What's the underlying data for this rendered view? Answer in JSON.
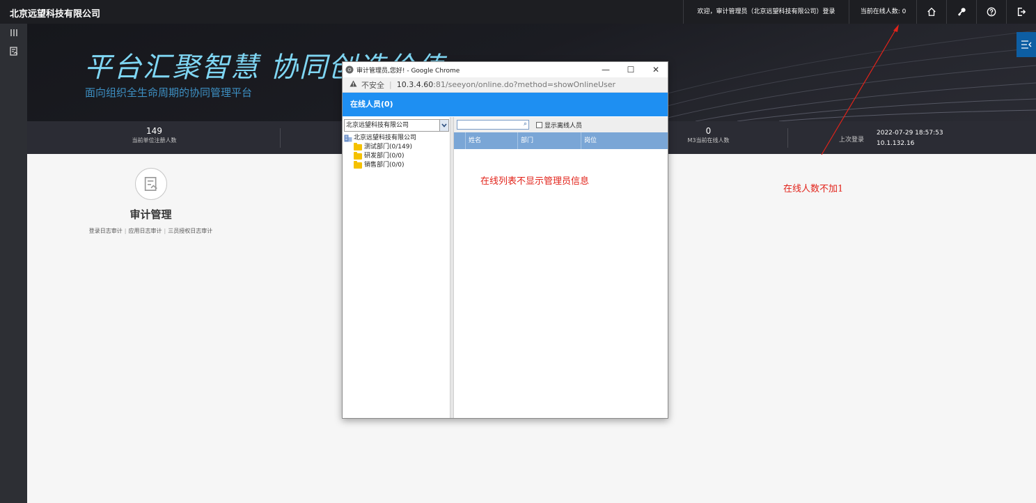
{
  "topbar": {
    "company": "北京远望科技有限公司",
    "welcome": "欢迎，审计管理员（北京远望科技有限公司）登录",
    "online_count": "当前在线人数: 0",
    "icons": [
      "home-icon",
      "key-icon",
      "help-icon",
      "logout-icon"
    ]
  },
  "banner": {
    "slogan": "平台汇聚智慧  协同创造价值",
    "subtitle": "面向组织全生命周期的协同管理平台"
  },
  "stats": {
    "registered_count": "149",
    "registered_label": "当前单位注册人数",
    "m3_count": "0",
    "m3_label": "M3当前在线人数",
    "last_login_label": "上次登录",
    "last_login_time": "2022-07-29 18:57:53",
    "last_login_ip": "10.1.132.16"
  },
  "audit": {
    "title": "审计管理",
    "links": [
      "登录日志审计",
      "应用日志审计",
      "三员授权日志审计"
    ]
  },
  "popup": {
    "window_title": "审计管理员,您好! - Google Chrome",
    "insecure_label": "不安全",
    "url_host": "10.3.4.60",
    "url_rest": ":81/seeyon/online.do?method=showOnlineUser",
    "header": "在线人员(0)",
    "org_select_value": "北京远望科技有限公司",
    "tree": {
      "root": "北京远望科技有限公司",
      "children": [
        "测试部门(0/149)",
        "研发部门(0/0)",
        "销售部门(0/0)"
      ]
    },
    "show_offline_label": "显示离线人员",
    "columns": [
      "姓名",
      "部门",
      "岗位"
    ]
  },
  "annotations": {
    "list_note": "在线列表不显示管理员信息",
    "count_note": "在线人数不加1"
  },
  "colors": {
    "annotation_red": "#e2231a",
    "popup_header_blue": "#1e8ff2",
    "grid_header_blue": "#7aa6d6"
  }
}
